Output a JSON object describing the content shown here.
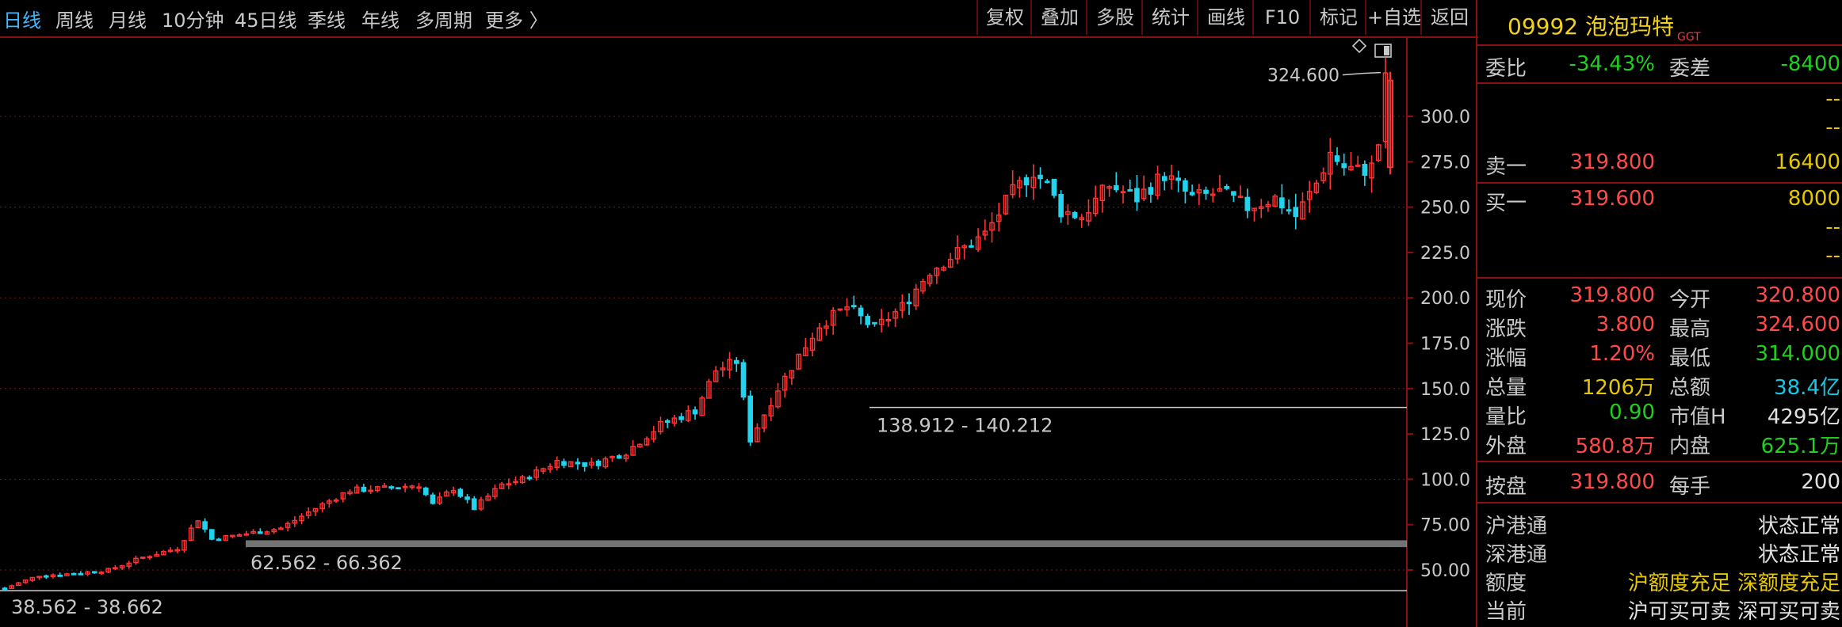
{
  "toolbar": {
    "periods": [
      "日线",
      "周线",
      "月线",
      "10分钟",
      "45日线",
      "季线",
      "年线",
      "多周期",
      "更多 〉"
    ],
    "active_period": "日线",
    "tools": [
      "复权",
      "叠加",
      "多股",
      "统计",
      "画线",
      "F10",
      "标记",
      "+自选",
      "返回"
    ]
  },
  "colors": {
    "up": "#ff3333",
    "down": "#22d3ee",
    "grid": "#7a1a1a",
    "axis": "#c8c8c8",
    "accent": "#3fb8ff"
  },
  "chart_data": {
    "type": "candlestick",
    "yticks": [
      "50.00",
      "75.00",
      "100.0",
      "125.0",
      "150.0",
      "175.0",
      "200.0",
      "225.0",
      "250.0",
      "275.0",
      "300.0"
    ],
    "ylim": [
      35,
      330
    ],
    "annotations": {
      "high_label": "324.600",
      "zone_high": "138.912 - 140.212",
      "zone_mid": "62.562 - 66.362",
      "zone_low": "38.562 - 38.662"
    },
    "path": [
      [
        0,
        40
      ],
      [
        5,
        47
      ],
      [
        10,
        48
      ],
      [
        15,
        50
      ],
      [
        20,
        57
      ],
      [
        25,
        62
      ],
      [
        28,
        78
      ],
      [
        30,
        67
      ],
      [
        35,
        70
      ],
      [
        40,
        73
      ],
      [
        45,
        84
      ],
      [
        50,
        94
      ],
      [
        55,
        95
      ],
      [
        60,
        97
      ],
      [
        62,
        86
      ],
      [
        65,
        95
      ],
      [
        68,
        84
      ],
      [
        72,
        97
      ],
      [
        75,
        100
      ],
      [
        80,
        110
      ],
      [
        85,
        108
      ],
      [
        90,
        115
      ],
      [
        95,
        130
      ],
      [
        100,
        138
      ],
      [
        103,
        160
      ],
      [
        106,
        165
      ],
      [
        108,
        122
      ],
      [
        112,
        150
      ],
      [
        115,
        168
      ],
      [
        118,
        185
      ],
      [
        122,
        195
      ],
      [
        126,
        183
      ],
      [
        130,
        195
      ],
      [
        134,
        215
      ],
      [
        138,
        225
      ],
      [
        142,
        235
      ],
      [
        146,
        258
      ],
      [
        149,
        270
      ],
      [
        151,
        262
      ],
      [
        153,
        248
      ],
      [
        156,
        245
      ],
      [
        160,
        262
      ],
      [
        164,
        255
      ],
      [
        168,
        268
      ],
      [
        172,
        255
      ],
      [
        176,
        258
      ],
      [
        180,
        250
      ],
      [
        184,
        255
      ],
      [
        187,
        245
      ],
      [
        190,
        263
      ],
      [
        192,
        280
      ],
      [
        194,
        272
      ],
      [
        196,
        270
      ],
      [
        198,
        272
      ],
      [
        199,
        285
      ],
      [
        200,
        319.8
      ]
    ]
  },
  "quote": {
    "code": "09992 泡泡玛特",
    "tag": "GGT",
    "weibi_label": "委比",
    "weibi": "-34.43%",
    "weicha_label": "委差",
    "weicha": "-8400",
    "dash": "--",
    "sell1_label": "卖一",
    "sell1_price": "319.800",
    "sell1_vol": "16400",
    "buy1_label": "买一",
    "buy1_price": "319.600",
    "buy1_vol": "8000",
    "rows": [
      {
        "l1": "现价",
        "v1": "319.800",
        "c1": "red",
        "l2": "今开",
        "v2": "320.800",
        "c2": "red"
      },
      {
        "l1": "涨跌",
        "v1": "3.800",
        "c1": "red",
        "l2": "最高",
        "v2": "324.600",
        "c2": "red"
      },
      {
        "l1": "涨幅",
        "v1": "1.20%",
        "c1": "red",
        "l2": "最低",
        "v2": "314.000",
        "c2": "green"
      },
      {
        "l1": "总量",
        "v1": "1206万",
        "c1": "yellow",
        "l2": "总额",
        "v2": "38.4亿",
        "c2": "cyan"
      },
      {
        "l1": "量比",
        "v1": "0.90",
        "c1": "green",
        "l2": "市值H",
        "v2": "4295亿",
        "c2": "white"
      },
      {
        "l1": "外盘",
        "v1": "580.8万",
        "c1": "red",
        "l2": "内盘",
        "v2": "625.1万",
        "c2": "green"
      }
    ],
    "after_label": "按盘",
    "after_price": "319.800",
    "lot_label": "每手",
    "lot": "200",
    "hk": [
      {
        "label": "沪港通",
        "value": "状态正常"
      },
      {
        "label": "深港通",
        "value": "状态正常"
      },
      {
        "label": "额度",
        "value": "沪额度充足  深额度充足"
      },
      {
        "label": "当前",
        "value": "沪可买可卖  深可买可卖"
      }
    ]
  }
}
